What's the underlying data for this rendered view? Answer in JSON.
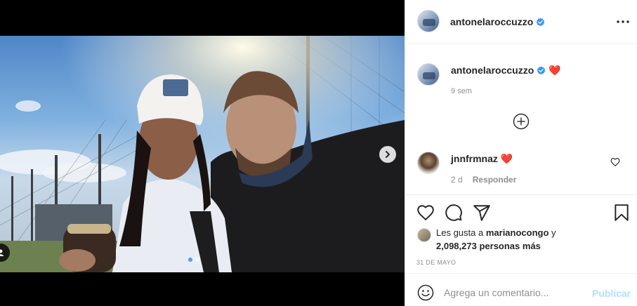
{
  "post": {
    "author": "antonelaroccuzzo",
    "image_count": 2,
    "active_image": 1
  },
  "caption": {
    "author": "antonelaroccuzzo",
    "emoji": "❤️",
    "time": "9 sem"
  },
  "comments": [
    {
      "author": "jnnfrmnaz",
      "emoji": "❤️",
      "time": "2 d",
      "reply_label": "Responder"
    }
  ],
  "likes": {
    "prefix": "Les gusta a",
    "user": "marianocongo",
    "connector": "y",
    "count": "2,098,273",
    "suffix": "personas más"
  },
  "date": "31 DE MAYO",
  "composer": {
    "placeholder": "Agrega un comentario...",
    "publish_label": "Publicar"
  },
  "colors": {
    "verified": "#3897f0",
    "heart": "#ed4956",
    "publish_disabled": "#b2dffc",
    "active_dot": "#4a9ff5"
  }
}
